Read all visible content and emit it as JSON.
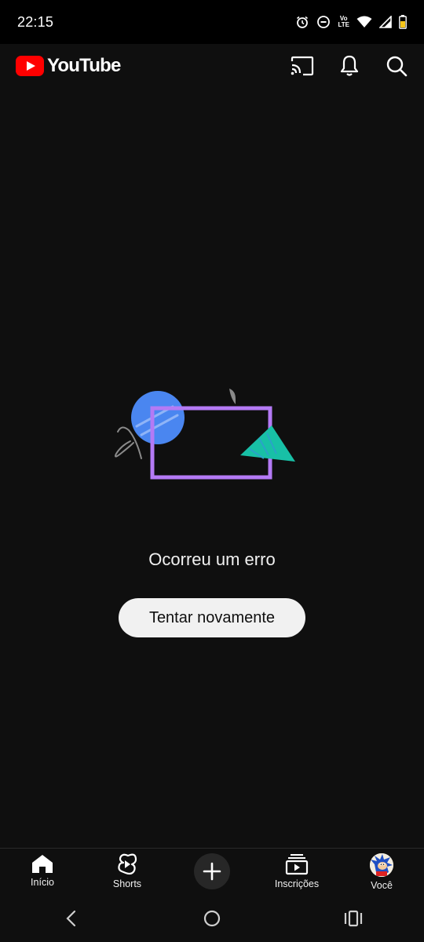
{
  "status_bar": {
    "time": "22:15",
    "volte_top": "Vo",
    "volte_bottom": "LTE",
    "icons": [
      "alarm-icon",
      "do-not-disturb-icon",
      "volte-icon",
      "wifi-icon",
      "signal-icon",
      "battery-icon"
    ]
  },
  "app_bar": {
    "brand": "YouTube",
    "brand_color": "#ff0000",
    "actions": [
      "cast-icon",
      "notifications-icon",
      "search-icon"
    ]
  },
  "error": {
    "message": "Ocorreu um erro",
    "retry_label": "Tentar novamente",
    "illustration_colors": [
      "#4285f4",
      "#b57cf5",
      "#1fbfa5",
      "#808080"
    ]
  },
  "bottom_nav": {
    "items": [
      {
        "label": "Início",
        "icon": "home-icon"
      },
      {
        "label": "Shorts",
        "icon": "shorts-icon"
      },
      {
        "label": "",
        "icon": "plus-icon"
      },
      {
        "label": "Inscrições",
        "icon": "subscriptions-icon"
      },
      {
        "label": "Você",
        "icon": "avatar"
      }
    ]
  },
  "system_nav": [
    "back-icon",
    "home-circle-icon",
    "recents-icon"
  ]
}
